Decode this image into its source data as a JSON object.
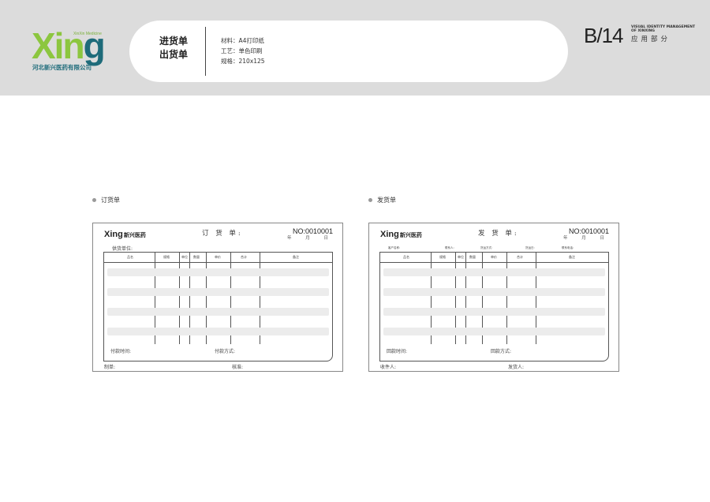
{
  "brand": {
    "logo_xin": "Xin",
    "logo_g": "g",
    "tagline": "XinXin Medicine",
    "company": "河北新兴医药有限公司",
    "form_logo": "Xing",
    "form_logo_cn": "新兴医药"
  },
  "header": {
    "titles": [
      "进货单",
      "出货单"
    ],
    "specs": [
      "材料：A4打印纸",
      "工艺：单色印刷",
      "规格：210x125"
    ],
    "page_code": "B/14",
    "page_en_1": "VISUAL IDENTITY MANAGEMENT",
    "page_en_2": "OF XINXING",
    "page_cn": "应用部分",
    "accent_green": "#8cc63f",
    "accent_teal": "#1e6b7a"
  },
  "sections": {
    "order_label": "订货单",
    "ship_label": "发货单"
  },
  "order_form": {
    "title": "订 货 单:",
    "no": "NO:0010001",
    "date": "年 月 日",
    "supplier": "供货单位:",
    "columns": [
      "品名",
      "规格",
      "单位",
      "数量",
      "单价",
      "合计",
      "备注"
    ],
    "payment_time": "付款时间:",
    "payment_method": "付款方式:",
    "made_by": "制单:",
    "checked_by": "核准:"
  },
  "ship_form": {
    "title": "发 货 单:",
    "no": "NO:0010001",
    "date": "年 月 日",
    "sub_fields": [
      "客户名称:",
      "联系人:",
      "货运方式:",
      "货运日:",
      "联系电话:"
    ],
    "columns": [
      "品名",
      "规格",
      "单位",
      "数量",
      "单价",
      "合计",
      "备注"
    ],
    "return_time": "回款时间:",
    "return_method": "回款方式:",
    "receiver": "收件人:",
    "sender": "发货人:"
  }
}
